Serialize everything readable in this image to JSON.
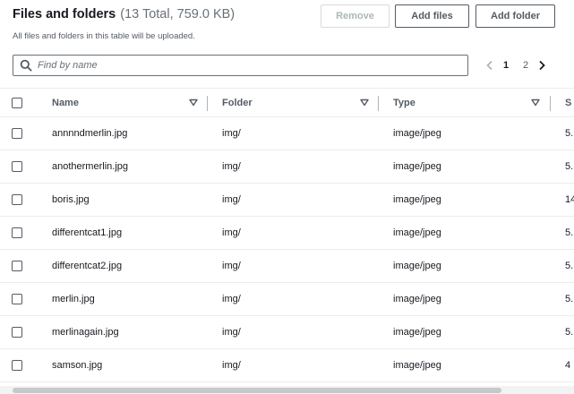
{
  "header": {
    "title": "Files and folders",
    "counter": "(13 Total, 759.0 KB)",
    "description": "All files and folders in this table will be uploaded."
  },
  "actions": {
    "remove_label": "Remove",
    "add_files_label": "Add files",
    "add_folder_label": "Add folder"
  },
  "search": {
    "placeholder": "Find by name"
  },
  "pagination": {
    "current_page": "1",
    "other_page": "2"
  },
  "table": {
    "columns": [
      "Name",
      "Folder",
      "Type",
      "S"
    ],
    "rows": [
      {
        "name": "annnndmerlin.jpg",
        "folder": "img/",
        "type": "image/jpeg",
        "size": "5."
      },
      {
        "name": "anothermerlin.jpg",
        "folder": "img/",
        "type": "image/jpeg",
        "size": "5."
      },
      {
        "name": "boris.jpg",
        "folder": "img/",
        "type": "image/jpeg",
        "size": "14"
      },
      {
        "name": "differentcat1.jpg",
        "folder": "img/",
        "type": "image/jpeg",
        "size": "5."
      },
      {
        "name": "differentcat2.jpg",
        "folder": "img/",
        "type": "image/jpeg",
        "size": "5."
      },
      {
        "name": "merlin.jpg",
        "folder": "img/",
        "type": "image/jpeg",
        "size": "5."
      },
      {
        "name": "merlinagain.jpg",
        "folder": "img/",
        "type": "image/jpeg",
        "size": "5."
      },
      {
        "name": "samson.jpg",
        "folder": "img/",
        "type": "image/jpeg",
        "size": "4"
      }
    ]
  },
  "icons": {
    "search": "search-icon",
    "sort": "caret-down-outline-icon",
    "prev": "chevron-left-icon",
    "next": "chevron-right-icon"
  },
  "colors": {
    "text": "#16191f",
    "secondary_text": "#545b64",
    "border": "#eaeded",
    "disabled": "#aab7b8"
  }
}
